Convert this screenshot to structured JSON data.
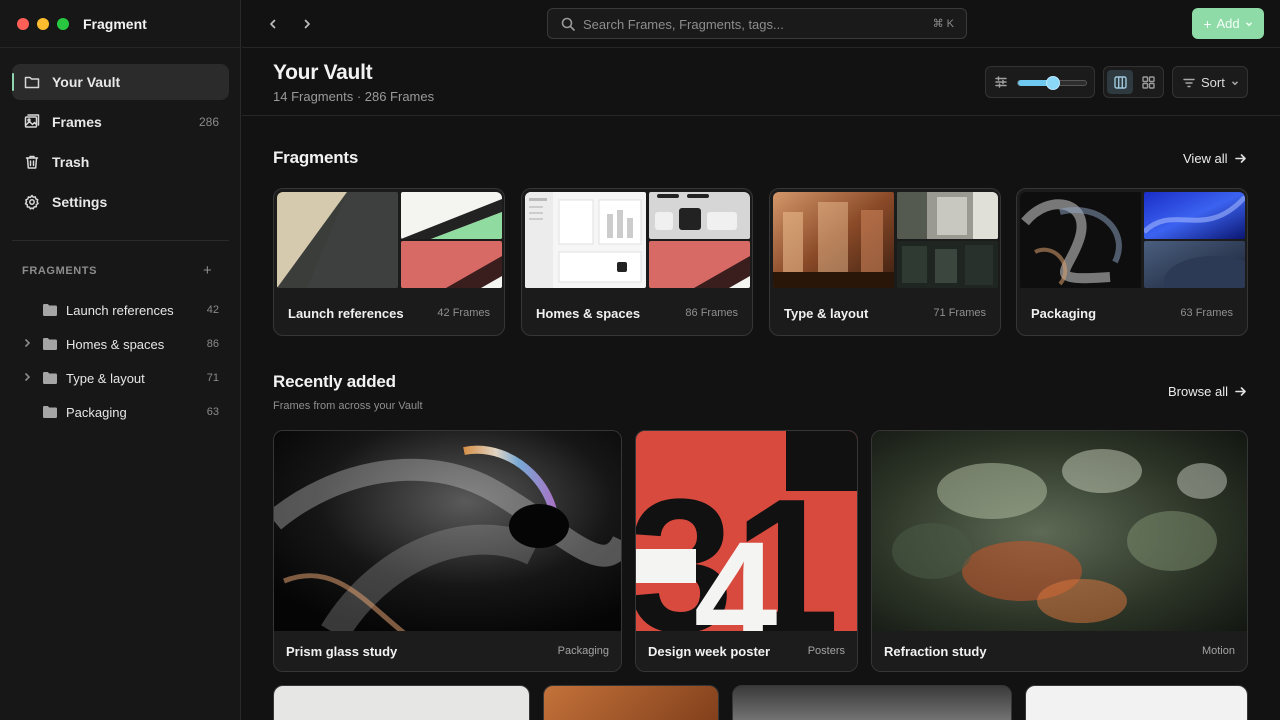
{
  "app": {
    "title": "Fragment"
  },
  "colors": {
    "traffic_close": "#ff5f57",
    "traffic_min": "#febc2e",
    "traffic_max": "#28c840",
    "accent": "#8fdba8",
    "slider": "#6ec8f0"
  },
  "sidebar": {
    "nav": [
      {
        "label": "Your Vault",
        "icon": "folder-icon",
        "count": "",
        "active": true
      },
      {
        "label": "Frames",
        "icon": "image-icon",
        "count": "286"
      },
      {
        "label": "Trash",
        "icon": "trash-icon",
        "count": ""
      },
      {
        "label": "Settings",
        "icon": "gear-icon",
        "count": ""
      }
    ],
    "section_label": "FRAGMENTS",
    "section_add": "+",
    "fragments": [
      {
        "label": "Launch references",
        "count": "42",
        "expandable": false
      },
      {
        "label": "Homes & spaces",
        "count": "86",
        "expandable": true
      },
      {
        "label": "Type & layout",
        "count": "71",
        "expandable": true
      },
      {
        "label": "Packaging",
        "count": "63",
        "expandable": false
      }
    ]
  },
  "topbar": {
    "search_placeholder": "Search Frames, Fragments, tags...",
    "search_shortcut": "⌘ K",
    "add_label": "Add",
    "add_plus": "+"
  },
  "header": {
    "title": "Your Vault",
    "subtitle": "14 Fragments · 286 Frames",
    "zoom_level": 0.5,
    "sort_label": "Sort"
  },
  "fragments_section": {
    "title": "Fragments",
    "link": "View all",
    "cards": [
      {
        "title": "Launch references",
        "count": "42 Frames"
      },
      {
        "title": "Homes & spaces",
        "count": "86 Frames"
      },
      {
        "title": "Type & layout",
        "count": "71 Frames"
      },
      {
        "title": "Packaging",
        "count": "63 Frames"
      }
    ]
  },
  "recent_section": {
    "title": "Recently added",
    "subtitle": "Frames from across your Vault",
    "link": "Browse all",
    "tiles": [
      {
        "title": "Prism glass study",
        "tag": "Packaging"
      },
      {
        "title": "Design week poster",
        "tag": "Posters"
      },
      {
        "title": "Refraction study",
        "tag": "Motion"
      }
    ]
  },
  "poster": {
    "digits": "31",
    "digit2": "4"
  }
}
